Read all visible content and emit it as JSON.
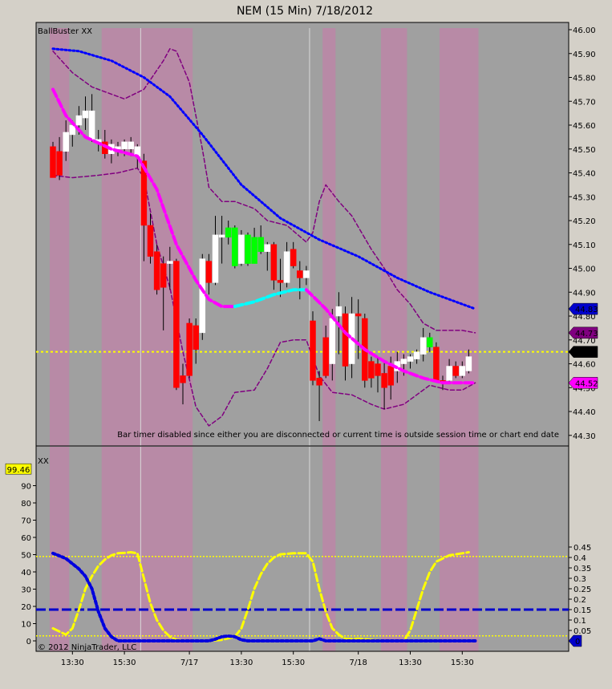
{
  "window": {
    "title": "NEM (15 Min)  7/18/2012"
  },
  "colors": {
    "background": "#a0a0a0",
    "outer": "#d4d0c8",
    "session_band": "#b88aa6",
    "up_candle": "#ffffff",
    "down_candle": "#ff0000",
    "squeeze_candle": "#00ff00",
    "blue_line": "#0000ff",
    "magenta_line": "#ff00ff",
    "cyan_line": "#00ffff",
    "band_line": "#800080",
    "yellow": "#ffff00"
  },
  "price_panel": {
    "indicator_label": "BallBuster XX",
    "note": "Bar timer disabled since either you are disconnected or current time is outside session time or chart end date",
    "price_ticks": [
      "46.00",
      "45.90",
      "45.80",
      "45.70",
      "45.60",
      "45.50",
      "45.40",
      "45.30",
      "45.20",
      "45.10",
      "45.00",
      "44.90",
      "44.80",
      "44.70",
      "44.60",
      "44.50",
      "44.40",
      "44.30"
    ],
    "markers": [
      {
        "label": "44.83",
        "value": 44.83,
        "color": "#0000cc",
        "text_color": "#ffffff"
      },
      {
        "label": "44.73",
        "value": 44.73,
        "color": "#800080",
        "text_color": "#ffffff"
      },
      {
        "label": "44.65",
        "value": 44.65,
        "color": "#000000",
        "text_color": "#ffffff"
      },
      {
        "label": "44.52",
        "value": 44.52,
        "color": "#ff00ff",
        "text_color": "#ffffff"
      }
    ]
  },
  "osc_panel": {
    "indicator_label": "XX",
    "left_ticks": [
      "0",
      "10",
      "20",
      "30",
      "40",
      "50",
      "60",
      "70",
      "80",
      "90"
    ],
    "right_ticks": [
      "0",
      "0.05",
      "0.1",
      "0.15",
      "0.2",
      "0.25",
      "0.3",
      "0.35",
      "0.4",
      "0.45"
    ],
    "left_marker": {
      "label": "99.46",
      "value": 99.46
    },
    "right_marker": {
      "label": "0",
      "value": 0
    }
  },
  "x_axis": {
    "labels": [
      {
        "label": "13:30",
        "bar": 3
      },
      {
        "label": "15:30",
        "bar": 11
      },
      {
        "label": "7/17",
        "bar": 21
      },
      {
        "label": "13:30",
        "bar": 29
      },
      {
        "label": "15:30",
        "bar": 37
      },
      {
        "label": "7/18",
        "bar": 47
      },
      {
        "label": "13:30",
        "bar": 55
      },
      {
        "label": "15:30",
        "bar": 63
      }
    ]
  },
  "copyright": "© 2012 NinjaTrader, LLC",
  "chart_data": {
    "type": "candlestick",
    "title": "NEM (15 Min)  7/18/2012",
    "ylim": [
      44.27,
      46.02
    ],
    "osc_ylim_left": [
      0,
      100
    ],
    "osc_ylim_right": [
      0,
      0.45
    ],
    "session_bands": [
      [
        0,
        2
      ],
      [
        8,
        21
      ],
      [
        42,
        43
      ],
      [
        51,
        54
      ],
      [
        60,
        65
      ]
    ],
    "day_separators": [
      13.5,
      39.5
    ],
    "candles": [
      {
        "o": 45.51,
        "h": 45.53,
        "l": 45.38,
        "c": 45.38,
        "k": "d"
      },
      {
        "o": 45.49,
        "h": 45.55,
        "l": 45.37,
        "c": 45.39,
        "k": "d"
      },
      {
        "o": 45.49,
        "h": 45.62,
        "l": 45.45,
        "c": 45.57,
        "k": "u"
      },
      {
        "o": 45.56,
        "h": 45.62,
        "l": 45.51,
        "c": 45.6,
        "k": "u"
      },
      {
        "o": 45.6,
        "h": 45.68,
        "l": 45.56,
        "c": 45.64,
        "k": "u"
      },
      {
        "o": 45.63,
        "h": 45.72,
        "l": 45.58,
        "c": 45.66,
        "k": "u"
      },
      {
        "o": 45.66,
        "h": 45.73,
        "l": 45.53,
        "c": 45.54,
        "k": "u"
      },
      {
        "o": 45.54,
        "h": 45.58,
        "l": 45.49,
        "c": 45.53,
        "k": "u"
      },
      {
        "o": 45.53,
        "h": 45.58,
        "l": 45.46,
        "c": 45.48,
        "k": "d"
      },
      {
        "o": 45.48,
        "h": 45.54,
        "l": 45.44,
        "c": 45.52,
        "k": "u"
      },
      {
        "o": 45.51,
        "h": 45.53,
        "l": 45.47,
        "c": 45.5,
        "k": "u"
      },
      {
        "o": 45.5,
        "h": 45.54,
        "l": 45.47,
        "c": 45.53,
        "k": "u"
      },
      {
        "o": 45.53,
        "h": 45.55,
        "l": 45.47,
        "c": 45.5,
        "k": "u"
      },
      {
        "o": 45.51,
        "h": 45.52,
        "l": 45.42,
        "c": 45.47,
        "k": "u"
      },
      {
        "o": 45.45,
        "h": 45.48,
        "l": 45.03,
        "c": 45.18,
        "k": "d"
      },
      {
        "o": 45.18,
        "h": 45.23,
        "l": 45.02,
        "c": 45.05,
        "k": "d"
      },
      {
        "o": 45.07,
        "h": 45.1,
        "l": 44.89,
        "c": 44.91,
        "k": "d"
      },
      {
        "o": 45.02,
        "h": 45.05,
        "l": 44.74,
        "c": 44.92,
        "k": "d"
      },
      {
        "o": 45.03,
        "h": 45.09,
        "l": 44.91,
        "c": 45.02,
        "k": "u"
      },
      {
        "o": 45.03,
        "h": 45.04,
        "l": 44.49,
        "c": 44.5,
        "k": "d"
      },
      {
        "o": 44.55,
        "h": 44.6,
        "l": 44.43,
        "c": 44.52,
        "k": "d"
      },
      {
        "o": 44.77,
        "h": 44.79,
        "l": 44.54,
        "c": 44.55,
        "k": "d"
      },
      {
        "o": 44.76,
        "h": 44.79,
        "l": 44.6,
        "c": 44.66,
        "k": "d"
      },
      {
        "o": 44.73,
        "h": 45.06,
        "l": 44.7,
        "c": 45.04,
        "k": "u"
      },
      {
        "o": 45.03,
        "h": 45.06,
        "l": 44.89,
        "c": 44.94,
        "k": "d"
      },
      {
        "o": 44.94,
        "h": 45.22,
        "l": 44.93,
        "c": 45.14,
        "k": "u"
      },
      {
        "o": 45.14,
        "h": 45.22,
        "l": 45.02,
        "c": 45.13,
        "k": "u"
      },
      {
        "o": 45.13,
        "h": 45.2,
        "l": 45.1,
        "c": 45.17,
        "k": "s"
      },
      {
        "o": 45.17,
        "h": 45.18,
        "l": 45.0,
        "c": 45.01,
        "k": "s"
      },
      {
        "o": 45.02,
        "h": 45.16,
        "l": 45.01,
        "c": 45.14,
        "k": "u"
      },
      {
        "o": 45.14,
        "h": 45.15,
        "l": 45.01,
        "c": 45.02,
        "k": "s"
      },
      {
        "o": 45.02,
        "h": 45.17,
        "l": 45.02,
        "c": 45.13,
        "k": "s"
      },
      {
        "o": 45.13,
        "h": 45.18,
        "l": 45.06,
        "c": 45.07,
        "k": "s"
      },
      {
        "o": 45.07,
        "h": 45.11,
        "l": 44.99,
        "c": 45.1,
        "k": "u"
      },
      {
        "o": 45.1,
        "h": 45.11,
        "l": 44.91,
        "c": 44.95,
        "k": "d"
      },
      {
        "o": 44.95,
        "h": 45.04,
        "l": 44.88,
        "c": 44.94,
        "k": "d"
      },
      {
        "o": 44.94,
        "h": 45.11,
        "l": 44.92,
        "c": 45.07,
        "k": "u"
      },
      {
        "o": 45.08,
        "h": 45.11,
        "l": 45.0,
        "c": 45.01,
        "k": "d"
      },
      {
        "o": 44.99,
        "h": 45.03,
        "l": 44.87,
        "c": 44.96,
        "k": "d"
      },
      {
        "o": 44.96,
        "h": 45.01,
        "l": 44.93,
        "c": 44.99,
        "k": "u"
      },
      {
        "o": 44.78,
        "h": 44.82,
        "l": 44.51,
        "c": 44.53,
        "k": "d"
      },
      {
        "o": 44.54,
        "h": 44.57,
        "l": 44.36,
        "c": 44.51,
        "k": "d"
      },
      {
        "o": 44.71,
        "h": 44.76,
        "l": 44.54,
        "c": 44.55,
        "k": "d"
      },
      {
        "o": 44.6,
        "h": 44.83,
        "l": 44.53,
        "c": 44.79,
        "k": "u"
      },
      {
        "o": 44.8,
        "h": 44.9,
        "l": 44.64,
        "c": 44.84,
        "k": "u"
      },
      {
        "o": 44.81,
        "h": 44.84,
        "l": 44.53,
        "c": 44.59,
        "k": "d"
      },
      {
        "o": 44.6,
        "h": 44.88,
        "l": 44.54,
        "c": 44.81,
        "k": "u"
      },
      {
        "o": 44.81,
        "h": 44.87,
        "l": 44.62,
        "c": 44.8,
        "k": "d"
      },
      {
        "o": 44.79,
        "h": 44.81,
        "l": 44.5,
        "c": 44.53,
        "k": "d"
      },
      {
        "o": 44.61,
        "h": 44.63,
        "l": 44.5,
        "c": 44.54,
        "k": "d"
      },
      {
        "o": 44.6,
        "h": 44.63,
        "l": 44.48,
        "c": 44.55,
        "k": "d"
      },
      {
        "o": 44.56,
        "h": 44.61,
        "l": 44.41,
        "c": 44.5,
        "k": "d"
      },
      {
        "o": 44.59,
        "h": 44.63,
        "l": 44.45,
        "c": 44.51,
        "k": "d"
      },
      {
        "o": 44.57,
        "h": 44.65,
        "l": 44.52,
        "c": 44.61,
        "k": "u"
      },
      {
        "o": 44.6,
        "h": 44.64,
        "l": 44.55,
        "c": 44.62,
        "k": "u"
      },
      {
        "o": 44.61,
        "h": 44.64,
        "l": 44.58,
        "c": 44.63,
        "k": "u"
      },
      {
        "o": 44.62,
        "h": 44.66,
        "l": 44.6,
        "c": 44.65,
        "k": "u"
      },
      {
        "o": 44.64,
        "h": 44.75,
        "l": 44.61,
        "c": 44.71,
        "k": "u"
      },
      {
        "o": 44.71,
        "h": 44.73,
        "l": 44.65,
        "c": 44.67,
        "k": "s"
      },
      {
        "o": 44.67,
        "h": 44.69,
        "l": 44.53,
        "c": 44.53,
        "k": "d"
      },
      {
        "o": 44.53,
        "h": 44.55,
        "l": 44.49,
        "c": 44.53,
        "k": "d"
      },
      {
        "o": 44.53,
        "h": 44.62,
        "l": 44.52,
        "c": 44.59,
        "k": "u"
      },
      {
        "o": 44.59,
        "h": 44.61,
        "l": 44.54,
        "c": 44.55,
        "k": "d"
      },
      {
        "o": 44.55,
        "h": 44.61,
        "l": 44.54,
        "c": 44.59,
        "k": "u"
      },
      {
        "o": 44.57,
        "h": 44.66,
        "l": 44.56,
        "c": 44.63,
        "k": "u"
      }
    ],
    "series": {
      "blue_dotted": [
        [
          0,
          45.92
        ],
        [
          4,
          45.91
        ],
        [
          9,
          45.87
        ],
        [
          14,
          45.8
        ],
        [
          18,
          45.72
        ],
        [
          23,
          45.56
        ],
        [
          29,
          45.35
        ],
        [
          35,
          45.21
        ],
        [
          41,
          45.12
        ],
        [
          47,
          45.05
        ],
        [
          53,
          44.96
        ],
        [
          58,
          44.9
        ],
        [
          65,
          44.83
        ]
      ],
      "magenta_ma": [
        [
          0,
          45.75
        ],
        [
          2,
          45.64
        ],
        [
          5,
          45.55
        ],
        [
          9,
          45.5
        ],
        [
          13,
          45.47
        ],
        [
          16,
          45.33
        ],
        [
          19,
          45.1
        ],
        [
          22,
          44.95
        ],
        [
          24,
          44.87
        ],
        [
          26,
          44.84
        ],
        [
          28,
          44.84
        ]
      ],
      "cyan_ma": [
        [
          28,
          44.84
        ],
        [
          31,
          44.86
        ],
        [
          34,
          44.89
        ],
        [
          37,
          44.91
        ],
        [
          39,
          44.91
        ]
      ],
      "magenta_ma2": [
        [
          39,
          44.91
        ],
        [
          42,
          44.83
        ],
        [
          45,
          44.73
        ],
        [
          48,
          44.66
        ],
        [
          51,
          44.61
        ],
        [
          54,
          44.57
        ],
        [
          57,
          44.54
        ],
        [
          60,
          44.52
        ],
        [
          63,
          44.52
        ],
        [
          65,
          44.52
        ]
      ],
      "upper_band": [
        [
          0,
          45.91
        ],
        [
          3,
          45.82
        ],
        [
          6,
          45.76
        ],
        [
          8,
          45.74
        ],
        [
          11,
          45.71
        ],
        [
          14,
          45.75
        ],
        [
          17,
          45.87
        ],
        [
          18,
          45.92
        ],
        [
          19,
          45.91
        ],
        [
          21,
          45.78
        ],
        [
          23,
          45.5
        ],
        [
          24,
          45.34
        ],
        [
          26,
          45.28
        ],
        [
          28,
          45.28
        ],
        [
          31,
          45.25
        ],
        [
          33,
          45.2
        ],
        [
          36,
          45.18
        ],
        [
          39,
          45.11
        ],
        [
          40,
          45.15
        ],
        [
          41,
          45.28
        ],
        [
          42,
          45.35
        ],
        [
          44,
          45.28
        ],
        [
          46,
          45.22
        ],
        [
          49,
          45.08
        ],
        [
          51,
          45.0
        ],
        [
          53,
          44.91
        ],
        [
          55,
          44.85
        ],
        [
          57,
          44.77
        ],
        [
          59,
          44.74
        ],
        [
          63,
          44.74
        ],
        [
          65,
          44.73
        ]
      ],
      "lower_band": [
        [
          0,
          45.39
        ],
        [
          3,
          45.38
        ],
        [
          7,
          45.39
        ],
        [
          10,
          45.4
        ],
        [
          13,
          45.42
        ],
        [
          14,
          45.38
        ],
        [
          16,
          45.1
        ],
        [
          18,
          44.92
        ],
        [
          20,
          44.65
        ],
        [
          22,
          44.42
        ],
        [
          24,
          44.34
        ],
        [
          26,
          44.38
        ],
        [
          28,
          44.48
        ],
        [
          31,
          44.49
        ],
        [
          33,
          44.58
        ],
        [
          35,
          44.69
        ],
        [
          37,
          44.7
        ],
        [
          39,
          44.7
        ],
        [
          41,
          44.55
        ],
        [
          43,
          44.48
        ],
        [
          46,
          44.47
        ],
        [
          49,
          44.43
        ],
        [
          51,
          44.41
        ],
        [
          54,
          44.43
        ],
        [
          56,
          44.47
        ],
        [
          58,
          44.51
        ],
        [
          61,
          44.49
        ],
        [
          63,
          44.49
        ],
        [
          65,
          44.52
        ]
      ],
      "yellow_osc": [
        [
          0,
          0.06
        ],
        [
          2,
          0.03
        ],
        [
          3,
          0.06
        ],
        [
          4,
          0.15
        ],
        [
          5,
          0.25
        ],
        [
          6,
          0.31
        ],
        [
          7,
          0.36
        ],
        [
          8,
          0.39
        ],
        [
          9,
          0.41
        ],
        [
          10,
          0.42
        ],
        [
          11,
          0.422
        ],
        [
          12,
          0.425
        ],
        [
          13,
          0.42
        ],
        [
          14,
          0.3
        ],
        [
          15,
          0.18
        ],
        [
          16,
          0.1
        ],
        [
          17,
          0.05
        ],
        [
          18,
          0.02
        ],
        [
          19,
          0.005
        ],
        [
          21,
          0.0
        ],
        [
          24,
          0.0
        ],
        [
          26,
          0.005
        ],
        [
          28,
          0.02
        ],
        [
          29,
          0.06
        ],
        [
          30,
          0.15
        ],
        [
          31,
          0.25
        ],
        [
          32,
          0.32
        ],
        [
          33,
          0.37
        ],
        [
          34,
          0.4
        ],
        [
          35,
          0.415
        ],
        [
          37,
          0.42
        ],
        [
          39,
          0.42
        ],
        [
          40,
          0.38
        ],
        [
          41,
          0.25
        ],
        [
          42,
          0.14
        ],
        [
          43,
          0.06
        ],
        [
          44,
          0.03
        ],
        [
          45,
          0.01
        ],
        [
          46,
          0.008
        ],
        [
          47,
          0.01
        ],
        [
          48,
          0.008
        ],
        [
          49,
          0.005
        ],
        [
          51,
          0.0
        ],
        [
          54,
          0.0
        ],
        [
          55,
          0.05
        ],
        [
          56,
          0.15
        ],
        [
          57,
          0.25
        ],
        [
          58,
          0.33
        ],
        [
          59,
          0.38
        ],
        [
          60,
          0.395
        ],
        [
          61,
          0.41
        ],
        [
          62,
          0.415
        ],
        [
          63,
          0.42
        ],
        [
          64,
          0.425
        ]
      ],
      "blue_osc": [
        [
          0,
          0.42
        ],
        [
          2,
          0.395
        ],
        [
          4,
          0.345
        ],
        [
          5,
          0.31
        ],
        [
          6,
          0.25
        ],
        [
          7,
          0.14
        ],
        [
          8,
          0.06
        ],
        [
          9,
          0.02
        ],
        [
          10,
          0.0
        ],
        [
          24,
          0.0
        ],
        [
          25,
          0.008
        ],
        [
          26,
          0.02
        ],
        [
          27,
          0.023
        ],
        [
          28,
          0.02
        ],
        [
          29,
          0.005
        ],
        [
          30,
          0.0
        ],
        [
          40,
          0.0
        ],
        [
          41,
          0.01
        ],
        [
          42,
          0.0
        ],
        [
          65,
          0.0
        ]
      ]
    },
    "level_lines": {
      "price_yellow": 44.65,
      "osc_blue": 0.15,
      "osc_yellow_upper": 0.405,
      "osc_yellow_lower": 0.024
    }
  }
}
